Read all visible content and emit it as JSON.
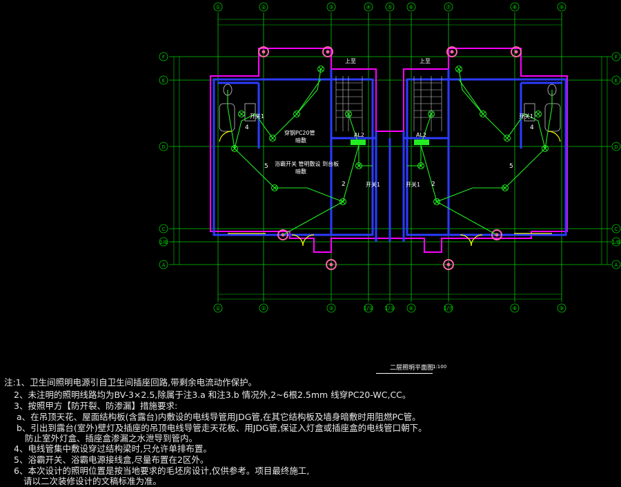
{
  "colors": {
    "background": "#000000",
    "axis": "#00d000",
    "wall": "#2b3cff",
    "outline": "#ff00ff",
    "circuit": "#22ee22",
    "text": "#ffffff",
    "column": "#ff66aa"
  },
  "grid_top_labels": [
    "①",
    "②",
    "③",
    "④",
    "⑤",
    "⑥",
    "⑦",
    "⑧",
    "⑨"
  ],
  "grid_bottom_labels": [
    "①",
    "②",
    "③",
    "1/②",
    "1/②",
    "⑥",
    "1/⑦",
    "⑧",
    "⑨"
  ],
  "grid_side_labels": [
    "F",
    "E",
    "D",
    "C",
    "1/B",
    "A"
  ],
  "plan_labels": {
    "up_left": "上至",
    "up_right": "上至",
    "tube_note": "穿钢PC20管",
    "dark_note": "暗敷",
    "panel_left": "AL2",
    "panel_right": "AL2",
    "bath_switch_note": "浴霸开关 管明敷设 到台板",
    "bath_switch_note2": "暗敷",
    "switch_left": "开关1",
    "switch_right": "开关1",
    "switch_mid_left": "开关1",
    "switch_mid_right": "开关1",
    "wire_5": "5",
    "wire_2": "2",
    "wire_4": "4"
  },
  "title_caption": "二层照明平面图",
  "scale": "1:100",
  "notes": [
    "注:1、卫生间照明电源引自卫生间插座回路,带剩余电流动作保护。",
    "2、未注明的照明线路均为BV-3×2.5,除属于注3.a 和注3.b 情况外,2~6根2.5mm   线穿PC20-WC,CC。",
    "3、按照甲方【防开裂、防渗漏】措施要求:",
    "a、在吊顶天花、屋面结构板(含露台)内敷设的电线导管用JDG管,在其它结构板及墙身暗敷时用阻燃PC管。",
    "b、引出到露台(室外)壁灯及插座的吊顶电线导管走天花板、用JDG管,保证入灯盒或插座盒的电线管口朝下。",
    "防止室外灯盒、插座盒渗漏之水泄导到管内。",
    "4、电线管集中敷设穿过结构梁时,只允许单排布置。",
    "5、浴霸开关、浴霸电源接线盒,尽量布置在2区外。",
    "6、本次设计的照明位置是按当地要求的毛坯房设计,仅供参考。项目最终施工,",
    "请以二次装修设计的文稿标准为准。"
  ]
}
